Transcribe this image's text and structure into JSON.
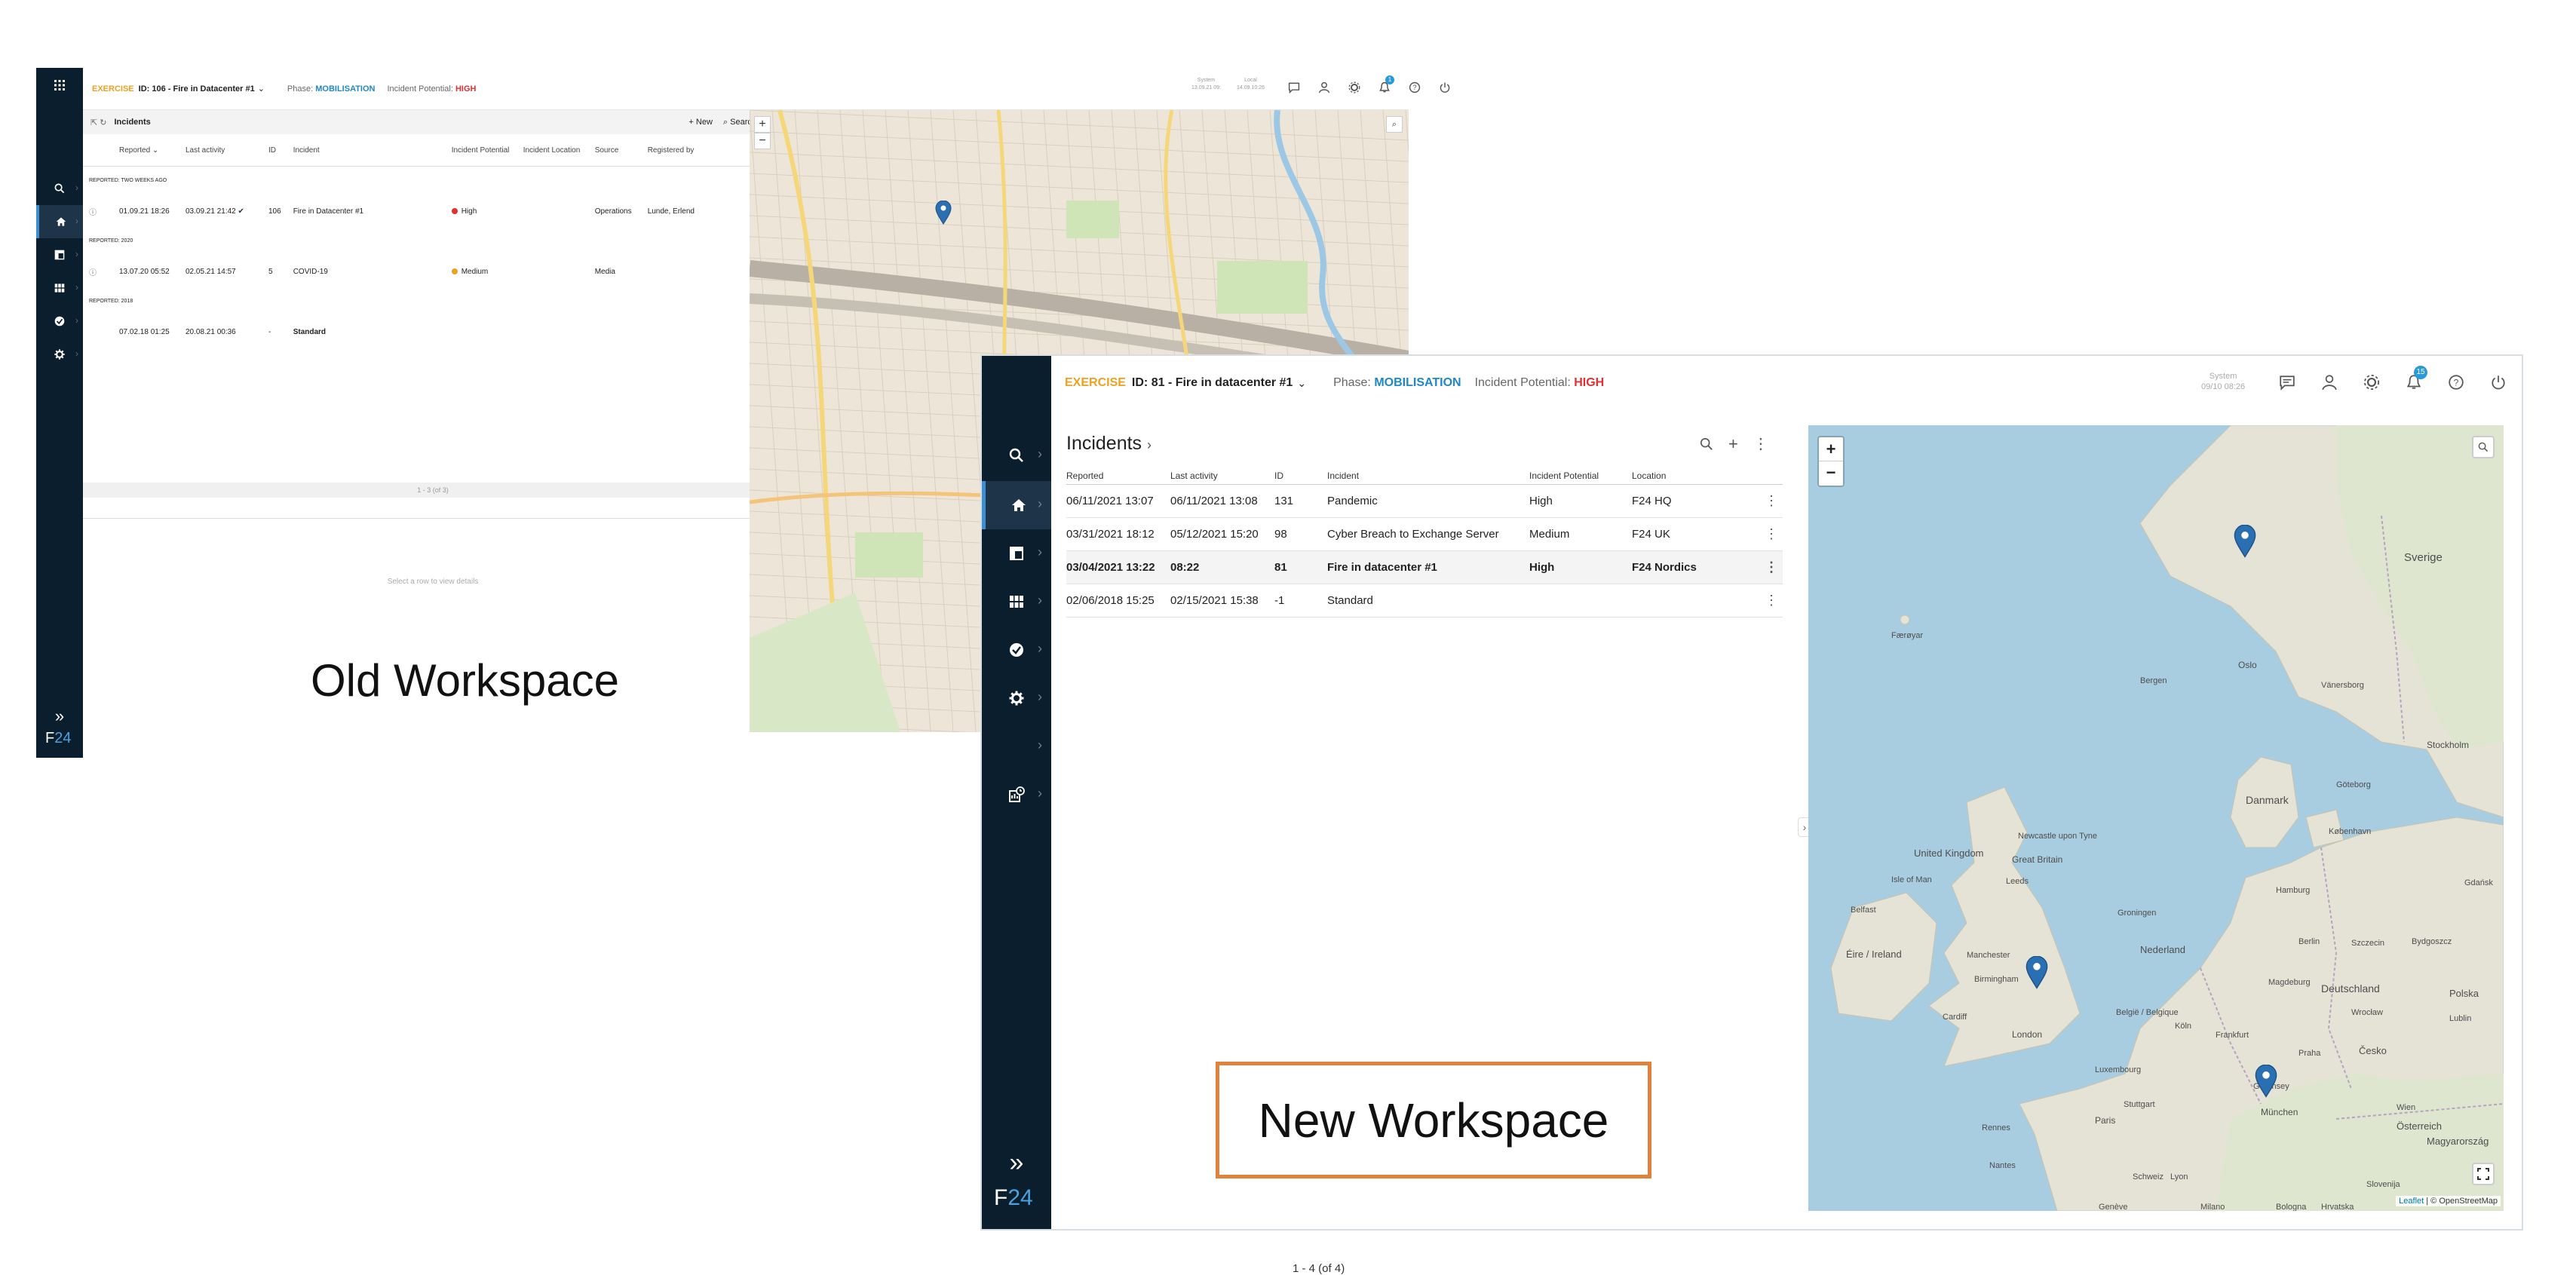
{
  "old_workspace": {
    "topbar": {
      "exercise": "EXERCISE",
      "incident_id": "ID: 106 - Fire in Datacenter #1",
      "phase_label": "Phase:",
      "phase": "MOBILISATION",
      "potential_label": "Incident Potential:",
      "potential": "HIGH",
      "system_label": "System",
      "system_time": "13.09.21 09:",
      "local_label": "Local",
      "local_time": "14.09.10:26",
      "notification_count": "1"
    },
    "panel": {
      "title": "Incidents",
      "new_label": "New",
      "search_label": "Search",
      "columns": [
        "Reported",
        "Last activity",
        "ID",
        "Incident",
        "Incident Potential",
        "Incident Location",
        "Source",
        "Registered by"
      ],
      "groups": [
        {
          "label": "REPORTED: TWO WEEKS AGO",
          "rows": [
            {
              "reported": "01.09.21 18:26",
              "last": "03.09.21 21:42",
              "id": "106",
              "incident": "Fire in Datacenter #1",
              "potential": "High",
              "potential_color": "#e03030",
              "source": "Operations",
              "registered": "Lunde, Erlend"
            }
          ]
        },
        {
          "label": "REPORTED: 2020",
          "rows": [
            {
              "reported": "13.07.20 05:52",
              "last": "02.05.21 14:57",
              "id": "5",
              "incident": "COVID-19",
              "potential": "Medium",
              "potential_color": "#f0a020",
              "source": "Media",
              "registered": ""
            }
          ]
        },
        {
          "label": "REPORTED: 2018",
          "rows": [
            {
              "reported": "07.02.18 01:25",
              "last": "20.08.21 00:36",
              "id": "-",
              "incident": "Standard",
              "potential": "",
              "potential_color": "",
              "source": "",
              "registered": ""
            }
          ]
        }
      ],
      "pager": "1 - 3 (of 3)",
      "empty_text": "Select a row to view details"
    },
    "brand": {
      "f": "F",
      "n": "24"
    },
    "label": "Old Workspace"
  },
  "new_workspace": {
    "topbar": {
      "exercise": "EXERCISE",
      "incident_id": "ID: 81 - Fire in datacenter #1",
      "phase_label": "Phase:",
      "phase": "MOBILISATION",
      "potential_label": "Incident Potential:",
      "potential": "HIGH",
      "system_label": "System",
      "system_time": "09/10 08:26",
      "notification_count": "15"
    },
    "panel": {
      "title": "Incidents",
      "columns": [
        "Reported",
        "Last activity",
        "ID",
        "Incident",
        "Incident Potential",
        "Location"
      ],
      "rows": [
        {
          "reported": "06/11/2021 13:07",
          "last": "06/11/2021 13:08",
          "id": "131",
          "incident": "Pandemic",
          "potential": "High",
          "location": "F24 HQ",
          "selected": false
        },
        {
          "reported": "03/31/2021 18:12",
          "last": "05/12/2021 15:20",
          "id": "98",
          "incident": "Cyber Breach to Exchange Server",
          "potential": "Medium",
          "location": "F24 UK",
          "selected": false
        },
        {
          "reported": "03/04/2021 13:22",
          "last": "08:22",
          "id": "81",
          "incident": "Fire in datacenter #1",
          "potential": "High",
          "location": "F24 Nordics",
          "selected": true
        },
        {
          "reported": "02/06/2018 15:25",
          "last": "02/15/2021 15:38",
          "id": "-1",
          "incident": "Standard",
          "potential": "",
          "location": "",
          "selected": false
        }
      ],
      "pager": "1  -  4 (of 4)"
    },
    "map": {
      "attribution_leaflet": "Leaflet",
      "attribution_osm": "| © OpenStreetMap",
      "places": [
        {
          "name": "Sverige",
          "size": 15
        },
        {
          "name": "Færøyar",
          "size": 11
        },
        {
          "name": "Bergen",
          "size": 11
        },
        {
          "name": "Oslo",
          "size": 12
        },
        {
          "name": "Stockholm",
          "size": 12
        },
        {
          "name": "Göteborg",
          "size": 11
        },
        {
          "name": "Danmark",
          "size": 14
        },
        {
          "name": "København",
          "size": 11
        },
        {
          "name": "United Kingdom",
          "size": 13
        },
        {
          "name": "Great Britain",
          "size": 12
        },
        {
          "name": "Newcastle upon Tyne",
          "size": 11
        },
        {
          "name": "Isle of Man",
          "size": 11
        },
        {
          "name": "Leeds",
          "size": 11
        },
        {
          "name": "Belfast",
          "size": 11
        },
        {
          "name": "Éire / Ireland",
          "size": 13
        },
        {
          "name": "Manchester",
          "size": 11
        },
        {
          "name": "Birmingham",
          "size": 11
        },
        {
          "name": "Cardiff",
          "size": 11
        },
        {
          "name": "London",
          "size": 12
        },
        {
          "name": "Hamburg",
          "size": 11
        },
        {
          "name": "Groningen",
          "size": 11
        },
        {
          "name": "Nederland",
          "size": 13
        },
        {
          "name": "Berlin",
          "size": 11
        },
        {
          "name": "Szczecin",
          "size": 11
        },
        {
          "name": "Bydgoszcz",
          "size": 11
        },
        {
          "name": "Deutschland",
          "size": 14
        },
        {
          "name": "Polska",
          "size": 13
        },
        {
          "name": "Magdeburg",
          "size": 11
        },
        {
          "name": "België / Belgique",
          "size": 11
        },
        {
          "name": "Köln",
          "size": 11
        },
        {
          "name": "Frankfurt",
          "size": 11
        },
        {
          "name": "Luxembourg",
          "size": 11
        },
        {
          "name": "Wrocław",
          "size": 11
        },
        {
          "name": "Lublin",
          "size": 11
        },
        {
          "name": "Praha",
          "size": 11
        },
        {
          "name": "Česko",
          "size": 13
        },
        {
          "name": "Guernsey",
          "size": 11
        },
        {
          "name": "Paris",
          "size": 12
        },
        {
          "name": "Stuttgart",
          "size": 11
        },
        {
          "name": "München",
          "size": 12
        },
        {
          "name": "Wien",
          "size": 11
        },
        {
          "name": "Österreich",
          "size": 13
        },
        {
          "name": "Magyarország",
          "size": 13
        },
        {
          "name": "Rennes",
          "size": 11
        },
        {
          "name": "Nantes",
          "size": 11
        },
        {
          "name": "Schweiz",
          "size": 11
        },
        {
          "name": "Genève",
          "size": 11
        },
        {
          "name": "Milano",
          "size": 11
        },
        {
          "name": "Slovenija",
          "size": 11
        },
        {
          "name": "Hrvatska",
          "size": 11
        },
        {
          "name": "Bologna",
          "size": 11
        },
        {
          "name": "Lyon",
          "size": 11
        },
        {
          "name": "Gdańsk",
          "size": 11
        },
        {
          "name": "Vänersborg",
          "size": 11
        }
      ]
    },
    "brand": {
      "f": "F",
      "n": "24"
    },
    "label": "New Workspace"
  },
  "colors": {
    "sidebar": "#0b1e2e",
    "accent": "#3d8ed0",
    "exercise": "#f0a020",
    "phase": "#1e88c7",
    "high": "#e03030",
    "callout": "#e0823c",
    "sea": "#a9cde0",
    "land": "#e5e3d6",
    "pin": "#2b6fb3"
  }
}
